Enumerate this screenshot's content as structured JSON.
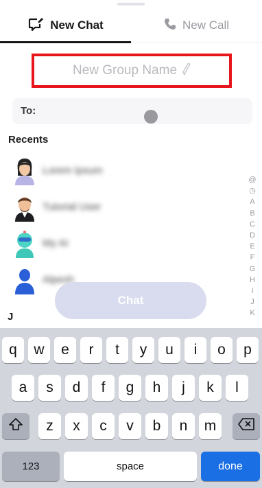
{
  "tabs": {
    "new_chat": "New Chat",
    "new_call": "New Call"
  },
  "group_name": {
    "placeholder": "New Group Name"
  },
  "to": {
    "label": "To:"
  },
  "recents": {
    "title": "Recents",
    "contacts": [
      {
        "name": "Lorem Ipsum",
        "avatar": "female-avatar"
      },
      {
        "name": "Tutorial User",
        "avatar": "male-avatar"
      },
      {
        "name": "My AI",
        "avatar": "robot-avatar"
      },
      {
        "name": "Alpesh",
        "avatar": "default-avatar"
      }
    ]
  },
  "alpha_index": [
    "@",
    "◷",
    "A",
    "B",
    "C",
    "D",
    "E",
    "F",
    "G",
    "H",
    "I",
    "J",
    "K"
  ],
  "chat_button": "Chat",
  "section_letter": "J",
  "keyboard": {
    "row1": [
      "q",
      "w",
      "e",
      "r",
      "t",
      "y",
      "u",
      "i",
      "o",
      "p"
    ],
    "row2": [
      "a",
      "s",
      "d",
      "f",
      "g",
      "h",
      "j",
      "k",
      "l"
    ],
    "row3": [
      "z",
      "x",
      "c",
      "v",
      "b",
      "n",
      "m"
    ],
    "shift_icon": "shift-icon",
    "delete_icon": "backspace-icon",
    "numbers": "123",
    "space": "space",
    "done": "done"
  },
  "colors": {
    "highlight_border": "#e8151d",
    "done_key": "#1a6fe4",
    "chat_button_bg": "#d8dcee"
  }
}
